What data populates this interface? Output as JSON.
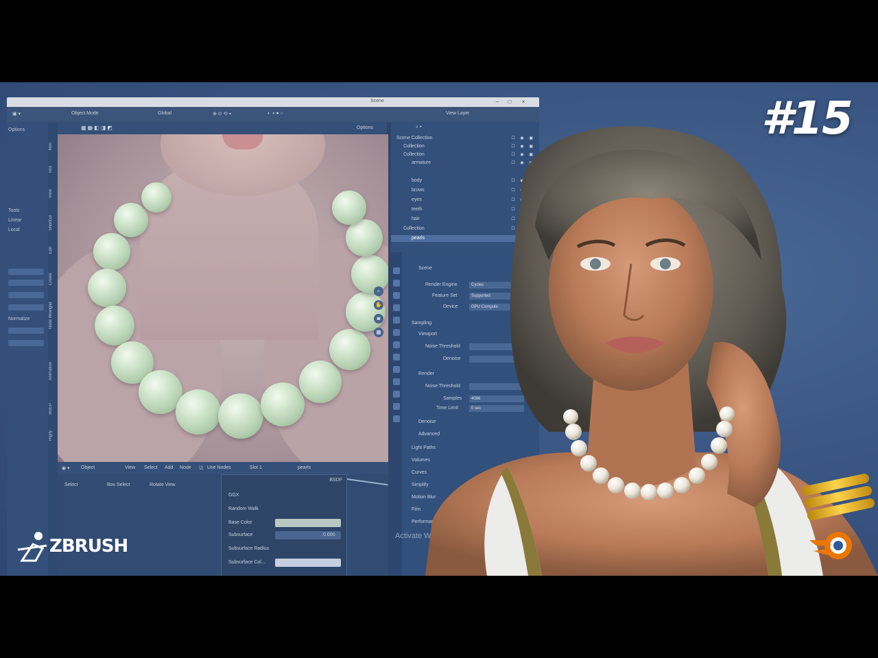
{
  "thumbnail": {
    "episode_label": "#15",
    "zbrush_brand": "ZBRUSH",
    "accent_orange": "#ea7600",
    "background_blue": "#3a5683"
  },
  "blender_window": {
    "title": "Scene",
    "view_layer": "View Layer",
    "header": {
      "mode": "Object Mode",
      "shading": "Global",
      "options": "Options"
    },
    "left_strip": {
      "texts": [
        "Options",
        "Tools",
        "Linear",
        "Local",
        "Normalize"
      ]
    },
    "vertical_tabs": [
      "Item",
      "Tool",
      "View",
      "Shortcut",
      "Edit",
      "Create",
      "Node Wrangler",
      "Animation",
      "BGEP",
      "Rigify"
    ],
    "viewport_bottom": {
      "editor": "Object",
      "menus": [
        "View",
        "Select",
        "Add",
        "Node"
      ],
      "use_nodes": "Use Nodes",
      "slot": "Slot 1",
      "material": "pearls"
    },
    "status": [
      "Select",
      "Box Select",
      "Rotate View"
    ],
    "node_panel": {
      "header": "BSDF",
      "rows": [
        "GGX",
        "Random Walk",
        "Base Color",
        "Subsurface",
        "Subsurface Radius",
        "Subsurface Col..."
      ],
      "subsurface_value": "0.000"
    },
    "outliner": {
      "search_placeholder": "",
      "rows": [
        "Scene Collection",
        "Collection",
        "Collection",
        "armature",
        "body",
        "brows",
        "eyes",
        "teeth",
        "hair",
        "Collection",
        "pearls"
      ]
    },
    "properties": {
      "section": "Scene",
      "render_engine_label": "Render Engine",
      "render_engine": "Cycles",
      "feature_set_label": "Feature Set",
      "feature_set": "Supported",
      "device_label": "Device",
      "device": "GPU Compute",
      "panels": [
        "Sampling",
        "Viewport",
        "Noise Threshold",
        "Denoise",
        "Render",
        "Noise Threshold",
        "Samples",
        "Time Limit",
        "Denoise",
        "Advanced",
        "Light Paths",
        "Volumes",
        "Curves",
        "Simplify",
        "Motion Blur",
        "Film",
        "Performance"
      ],
      "samples": "4096",
      "time_limit": "0 sec",
      "watermark": "Activate Windows"
    }
  }
}
